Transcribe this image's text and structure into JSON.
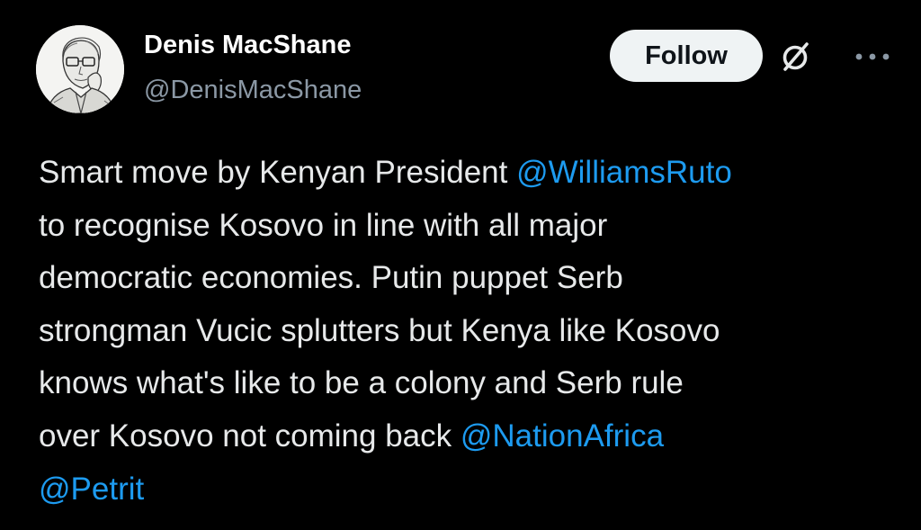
{
  "author": {
    "name": "Denis MacShane",
    "handle": "@DenisMacShane"
  },
  "actions": {
    "follow_label": "Follow",
    "grok_icon": "slashed-circle-icon",
    "more_icon": "more-dots-icon"
  },
  "tweet": {
    "lines": [
      {
        "text": "Smart move by Kenyan President ",
        "mention": "@WilliamsRuto"
      },
      {
        "text": "to recognise Kosovo in line with all major"
      },
      {
        "text": "democratic economies. Putin puppet Serb"
      },
      {
        "text": "strongman Vucic splutters but Kenya like Kosovo"
      },
      {
        "text": "knows what's like to be a colony and Serb rule"
      },
      {
        "text": "over Kosovo not coming back ",
        "mention": "@NationAfrica"
      },
      {
        "mention": "@Petrit"
      }
    ]
  },
  "colors": {
    "background": "#000000",
    "text": "#e7e9ea",
    "secondary": "#8b98a5",
    "link": "#1d9bf0",
    "button_bg": "#eff3f4"
  }
}
